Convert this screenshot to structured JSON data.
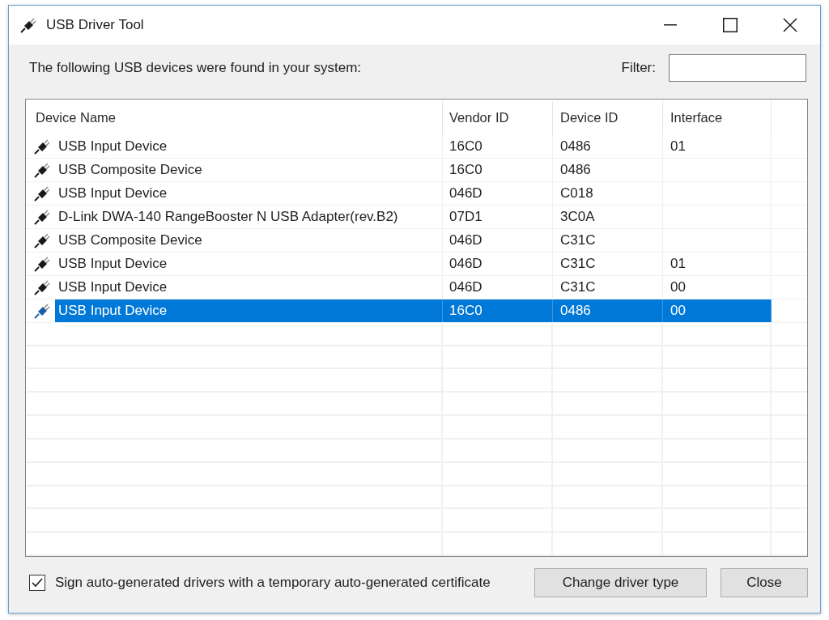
{
  "window": {
    "title": "USB Driver Tool"
  },
  "intro": "The following USB devices were found in your system:",
  "filter": {
    "label": "Filter:"
  },
  "table": {
    "columns": [
      "Device Name",
      "Vendor ID",
      "Device ID",
      "Interface"
    ],
    "rows": [
      {
        "device_name": "USB Input Device",
        "vendor_id": "16C0",
        "device_id": "0486",
        "interface": "01",
        "selected": false
      },
      {
        "device_name": "USB Composite Device",
        "vendor_id": "16C0",
        "device_id": "0486",
        "selected": false
      },
      {
        "device_name": "USB Input Device",
        "vendor_id": "046D",
        "device_id": "C018",
        "selected": false
      },
      {
        "device_name": "D-Link DWA-140 RangeBooster N USB Adapter(rev.B2)",
        "vendor_id": "07D1",
        "device_id": "3C0A",
        "selected": false
      },
      {
        "device_name": "USB Composite Device",
        "vendor_id": "046D",
        "device_id": "C31C",
        "selected": false
      },
      {
        "device_name": "USB Input Device",
        "vendor_id": "046D",
        "device_id": "C31C",
        "interface": "01",
        "selected": false
      },
      {
        "device_name": "USB Input Device",
        "vendor_id": "046D",
        "device_id": "C31C",
        "interface": "00",
        "selected": false
      },
      {
        "device_name": "USB Input Device",
        "vendor_id": "16C0",
        "device_id": "0486",
        "interface": "00",
        "selected": true
      }
    ]
  },
  "sign_option": {
    "label": "Sign auto-generated drivers with a temporary auto-generated certificate",
    "checked": true
  },
  "buttons": [
    "Change driver type",
    "Close"
  ]
}
